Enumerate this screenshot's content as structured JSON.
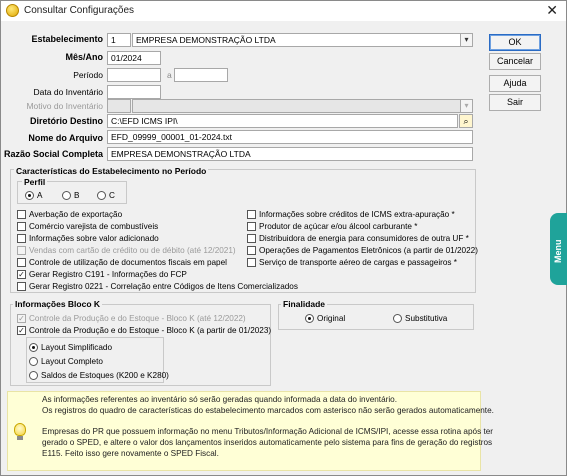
{
  "window": {
    "title": "Consultar Configurações",
    "close_glyph": "✕",
    "icon": "app-coin-icon"
  },
  "form": {
    "estabelecimento": {
      "label": "Estabelecimento",
      "code": "1",
      "name": "EMPRESA DEMONSTRAÇÃO LTDA"
    },
    "mes_ano": {
      "label": "Mês/Ano",
      "value": "01/2024"
    },
    "periodo": {
      "label": "Período",
      "from": "",
      "separator": "a",
      "to": ""
    },
    "data_inventario": {
      "label": "Data do Inventário",
      "value": ""
    },
    "motivo_inventario": {
      "label": "Motivo do Inventário",
      "code": "",
      "value": ""
    },
    "diretorio_destino": {
      "label": "Diretório Destino",
      "value": "C:\\EFD ICMS IPI\\"
    },
    "nome_arquivo": {
      "label": "Nome do Arquivo",
      "value": "EFD_09999_00001_01-2024.txt"
    },
    "razao_social": {
      "label": "Razão Social Completa",
      "value": "EMPRESA DEMONSTRAÇÃO LTDA"
    }
  },
  "buttons": {
    "ok": "OK",
    "cancelar": "Cancelar",
    "ajuda": "Ajuda",
    "sair": "Sair"
  },
  "caracteristicas": {
    "title": "Características do Estabelecimento no Período",
    "perfil": {
      "label": "Perfil",
      "options": [
        "A",
        "B",
        "C"
      ],
      "selected": "A"
    },
    "left": [
      {
        "label": "Averbação de exportação",
        "checked": false,
        "disabled": false
      },
      {
        "label": "Comércio varejista de combustíveis",
        "checked": false,
        "disabled": false
      },
      {
        "label": "Informações sobre valor adicionado",
        "checked": false,
        "disabled": false
      },
      {
        "label": "Vendas com cartão de crédito ou de débito (até 12/2021)",
        "checked": false,
        "disabled": true
      },
      {
        "label": "Controle de utilização de documentos fiscais em papel",
        "checked": false,
        "disabled": false
      },
      {
        "label": "Gerar Registro C191 - Informações do FCP",
        "checked": true,
        "disabled": false
      },
      {
        "label": "Gerar Registro 0221 - Correlação entre Códigos de Itens Comercializados",
        "checked": false,
        "disabled": false
      }
    ],
    "right": [
      {
        "label": "Informações sobre créditos de ICMS extra-apuração *",
        "checked": false
      },
      {
        "label": "Produtor de açúcar e/ou álcool carburante *",
        "checked": false
      },
      {
        "label": "Distribuidora de energia para consumidores de outra UF *",
        "checked": false
      },
      {
        "label": "Operações de Pagamentos Eletrônicos (a partir de 01/2022)",
        "checked": false
      },
      {
        "label": "Serviço de transporte aéreo de cargas e passageiros *",
        "checked": false
      }
    ]
  },
  "bloco_k": {
    "title": "Informações Bloco K",
    "checks": [
      {
        "label": "Controle da Produção e do Estoque - Bloco K (até 12/2022)",
        "checked": true,
        "disabled": true
      },
      {
        "label": "Controle da Produção e do Estoque - Bloco K (a partir de 01/2023)",
        "checked": true,
        "disabled": false
      }
    ],
    "layouts": [
      "Layout Simplificado",
      "Layout Completo",
      "Saldos de Estoques (K200 e K280)"
    ],
    "layout_selected": "Layout Simplificado"
  },
  "finalidade": {
    "title": "Finalidade",
    "options": [
      "Original",
      "Substitutiva"
    ],
    "selected": "Original"
  },
  "side_tab": {
    "label": "Menu"
  },
  "info": {
    "lines": [
      "As informações referentes ao inventário só serão geradas quando informada a data do inventário.",
      "Os registros do quadro de características do estabelecimento marcados com asterisco não serão gerados automaticamente.",
      "Empresas do PR que possuem informação no menu Tributos/Informação Adicional de ICMS/IPI, acesse essa rotina após ter",
      "gerado o SPED, e altere o valor dos lançamentos inseridos automaticamente pelo sistema para fins de geração do registros",
      "E115. Feito isso gere novamente o SPED Fiscal."
    ]
  },
  "colors": {
    "accent": "#2a6bc4",
    "menu_tab": "#1fa39a",
    "info_bg": "#ffffd6"
  }
}
